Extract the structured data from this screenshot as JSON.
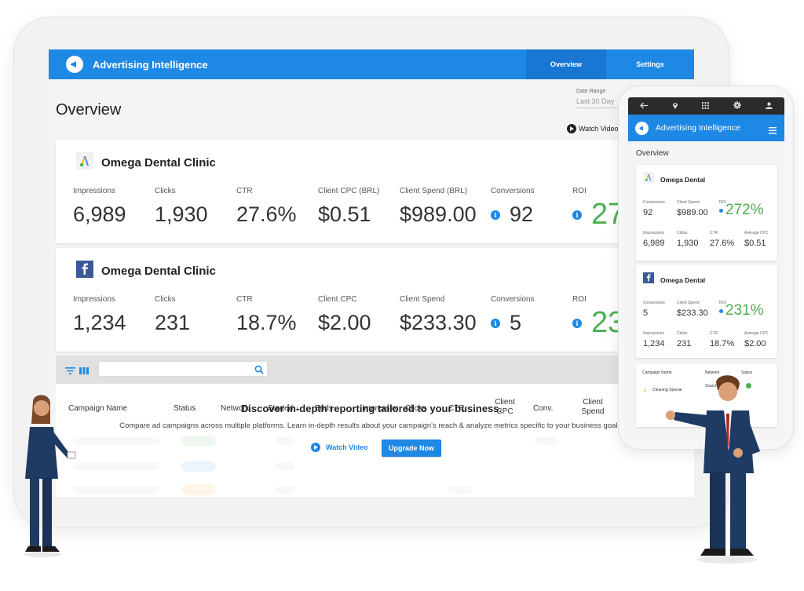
{
  "app": {
    "title": "Advertising Intelligence"
  },
  "top_tabs": [
    {
      "label": "Overview"
    },
    {
      "label": "Settings"
    }
  ],
  "page": {
    "title": "Overview",
    "date_range_label": "Date Range",
    "date_range_value": "Last 30 Day",
    "watch_video": "Watch Video"
  },
  "cards": [
    {
      "brand": "Omega Dental Clinic",
      "network_icon": "google-ads-icon",
      "metrics": [
        {
          "label": "Impressions",
          "value": "6,989"
        },
        {
          "label": "Clicks",
          "value": "1,930"
        },
        {
          "label": "CTR",
          "value": "27.6%"
        },
        {
          "label": "Client CPC (BRL)",
          "value": "$0.51"
        },
        {
          "label": "Client Spend (BRL)",
          "value": "$989.00"
        },
        {
          "label": "Conversions",
          "value": "92"
        },
        {
          "label": "ROI",
          "value": "27"
        }
      ]
    },
    {
      "brand": "Omega Dental Clinic",
      "network_icon": "facebook-icon",
      "metrics": [
        {
          "label": "Impressions",
          "value": "1,234"
        },
        {
          "label": "Clicks",
          "value": "231"
        },
        {
          "label": "CTR",
          "value": "18.7%"
        },
        {
          "label": "Client CPC",
          "value": "$2.00"
        },
        {
          "label": "Client Spend",
          "value": "$233.30"
        },
        {
          "label": "Conversions",
          "value": "5"
        },
        {
          "label": "ROI",
          "value": "23"
        }
      ]
    }
  ],
  "table": {
    "columns": [
      "Campaign Name",
      "Status",
      "Network",
      "Started",
      "Ends",
      "Impressior",
      "Clicks",
      "CTR",
      "Client CPC",
      "Conv.",
      "Client Spend"
    ]
  },
  "promo": {
    "title": "Discover in-depth reporting tailored to your business.",
    "subtitle": "Compare ad campaigns across multiple platforms. Learn in-depth results about your campaign's reach & analyze metrics specific to your business goals.",
    "watch_video": "Watch Video",
    "upgrade": "Upgrade Now"
  },
  "phone": {
    "title": "Advertising Intelligence",
    "overview": "Overview",
    "cards": [
      {
        "brand": "Omega Dental",
        "row1": [
          {
            "label": "Conversions",
            "value": "92"
          },
          {
            "label": "Client Spend",
            "value": "$989.00"
          },
          {
            "label": "ROI",
            "value": "272%"
          }
        ],
        "row2": [
          {
            "label": "Impressions",
            "value": "6,989"
          },
          {
            "label": "Clicks",
            "value": "1,930"
          },
          {
            "label": "CTR",
            "value": "27.6%"
          },
          {
            "label": "Average CPC",
            "value": "$0.51"
          }
        ]
      },
      {
        "brand": "Omega Dental",
        "row1": [
          {
            "label": "Conversions",
            "value": "5"
          },
          {
            "label": "Client Spend",
            "value": "$233.30"
          },
          {
            "label": "ROI",
            "value": "231%"
          }
        ],
        "row2": [
          {
            "label": "Impressions",
            "value": "1,234"
          },
          {
            "label": "Clicks",
            "value": "231"
          },
          {
            "label": "CTR",
            "value": "18.7%"
          },
          {
            "label": "Average CPC",
            "value": "$2.00"
          }
        ]
      }
    ],
    "table": {
      "columns": [
        "Campaign Name",
        "Network",
        "Status"
      ],
      "row": {
        "name": "Cleaning Special",
        "network": "Search"
      }
    }
  },
  "colors": {
    "primary": "#1e88e5",
    "primary_dark": "#1976d2",
    "positive": "#4caf50"
  }
}
